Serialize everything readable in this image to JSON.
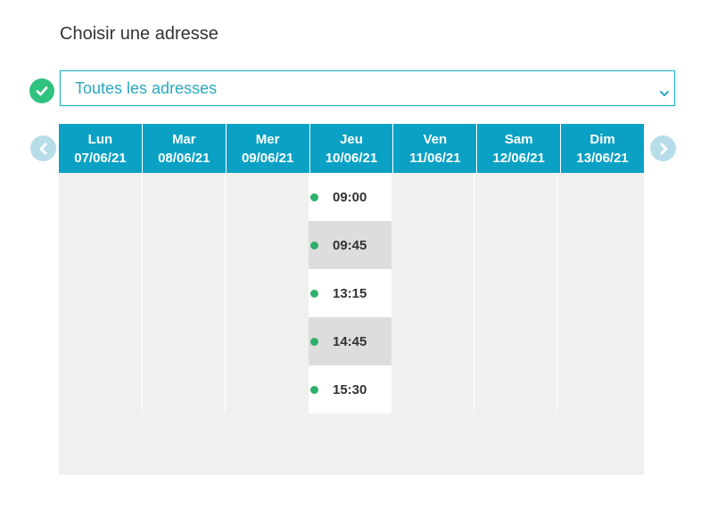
{
  "page": {
    "title": "Choisir une adresse"
  },
  "address_select": {
    "selected": "Toutes les adresses"
  },
  "calendar": {
    "days": [
      {
        "name": "Lun",
        "date": "07/06/21"
      },
      {
        "name": "Mar",
        "date": "08/06/21"
      },
      {
        "name": "Mer",
        "date": "09/06/21"
      },
      {
        "name": "Jeu",
        "date": "10/06/21"
      },
      {
        "name": "Ven",
        "date": "11/06/21"
      },
      {
        "name": "Sam",
        "date": "12/06/21"
      },
      {
        "name": "Dim",
        "date": "13/06/21"
      }
    ],
    "slots_day": "Jeu",
    "slots": [
      "09:00",
      "09:45",
      "13:15",
      "14:45",
      "15:30"
    ]
  },
  "colors": {
    "header_bg": "#0aa1c4",
    "select_text": "#2aa8bd",
    "available_dot": "#2fb06a",
    "check": "#2ec27e"
  },
  "icons": {
    "check": "check-circle-icon",
    "prev": "chevron-left-icon",
    "next": "chevron-right-icon",
    "dropdown": "chevron-down-icon"
  }
}
